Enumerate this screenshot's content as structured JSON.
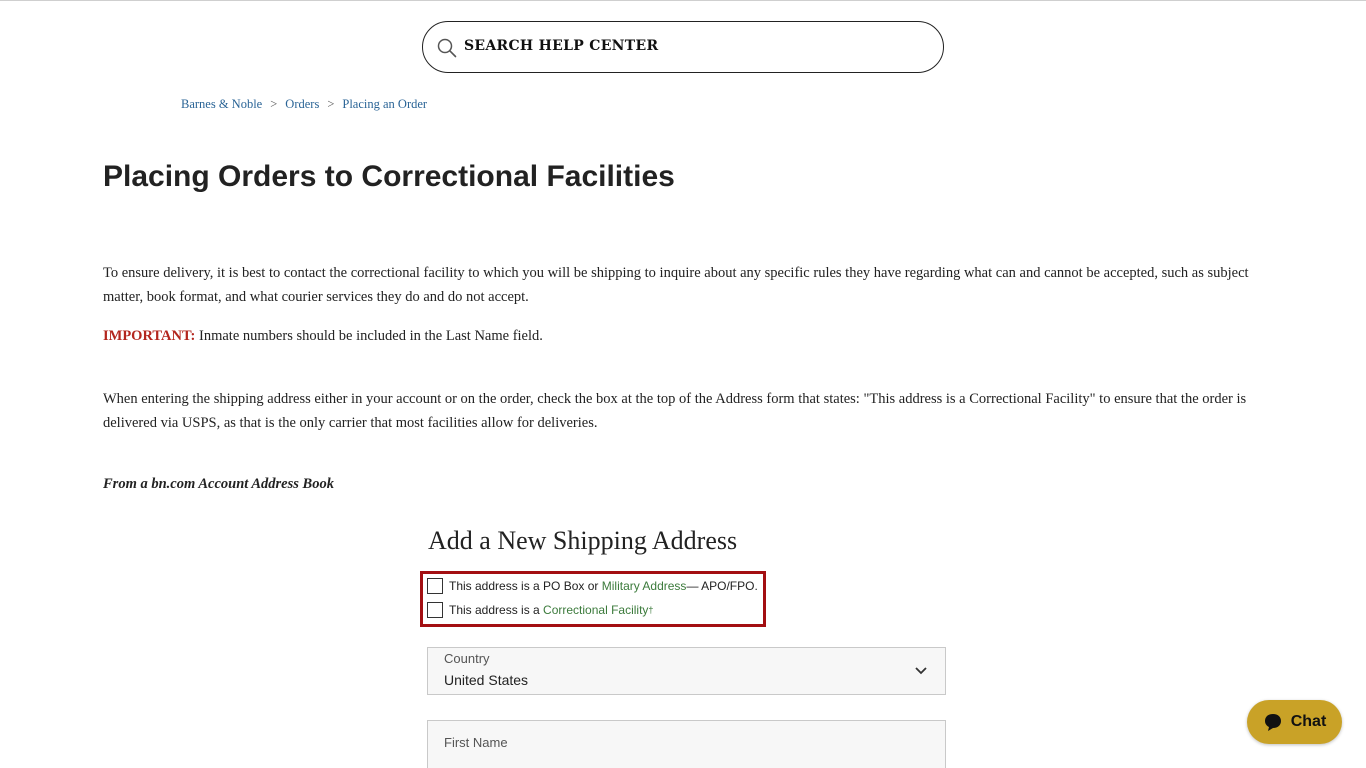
{
  "search": {
    "placeholder": "SEARCH HELP CENTER",
    "icon": "search-icon"
  },
  "breadcrumb": {
    "items": [
      "Barnes & Noble",
      "Orders",
      "Placing an Order"
    ],
    "separator": ">"
  },
  "page_title": "Placing Orders to Correctional Facilities",
  "content": {
    "para1": "To ensure delivery, it is best to contact the correctional facility to which you will be shipping to inquire about any specific rules they have regarding what can and cannot be accepted, such as subject matter, book format, and what courier services they do and do not accept.",
    "important_label": "IMPORTANT:",
    "important_text": " Inmate numbers should be included in the Last Name field.",
    "para3": "When entering the shipping address either in your account or on the order, check the box at the top of the Address form that states: \"This address is a Correctional Facility\" to ensure that the order is delivered via USPS, as that is the only carrier that most facilities allow for deliveries.",
    "subhead": "From a bn.com Account Address Book"
  },
  "form_image": {
    "heading": "Add a New Shipping Address",
    "checkbox1": {
      "prefix": "This address is a PO Box or ",
      "link": "Military Address",
      "suffix": " — APO/FPO."
    },
    "checkbox2": {
      "prefix": "This address is a ",
      "link": "Correctional Facility",
      "sup": "†"
    },
    "country": {
      "label": "Country",
      "value": "United States"
    },
    "first_name": {
      "label": "First Name"
    },
    "highlight_color": "#a30f12"
  },
  "chat": {
    "label": "Chat",
    "color": "#c9a227"
  }
}
